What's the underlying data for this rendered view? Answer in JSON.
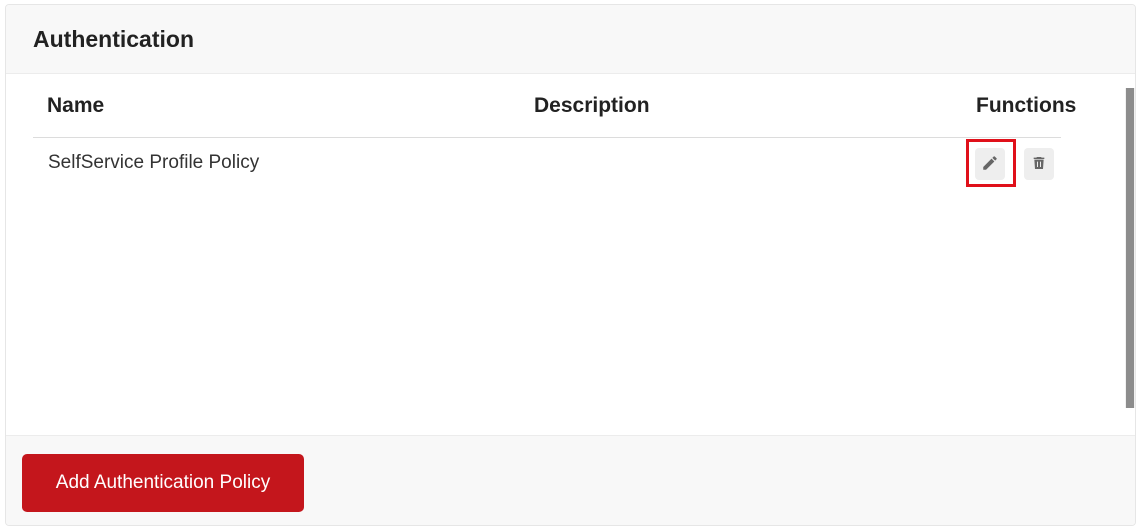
{
  "panel": {
    "title": "Authentication"
  },
  "table": {
    "columns": {
      "name": "Name",
      "description": "Description",
      "functions": "Functions"
    },
    "rows": [
      {
        "name": "SelfService Profile Policy",
        "description": ""
      }
    ]
  },
  "icons": {
    "edit": "pencil-icon",
    "delete": "trash-icon"
  },
  "colors": {
    "primary": "#c4161c",
    "highlight": "#e0101a",
    "icon": "#666666"
  },
  "footer": {
    "add_button_label": "Add Authentication Policy"
  }
}
